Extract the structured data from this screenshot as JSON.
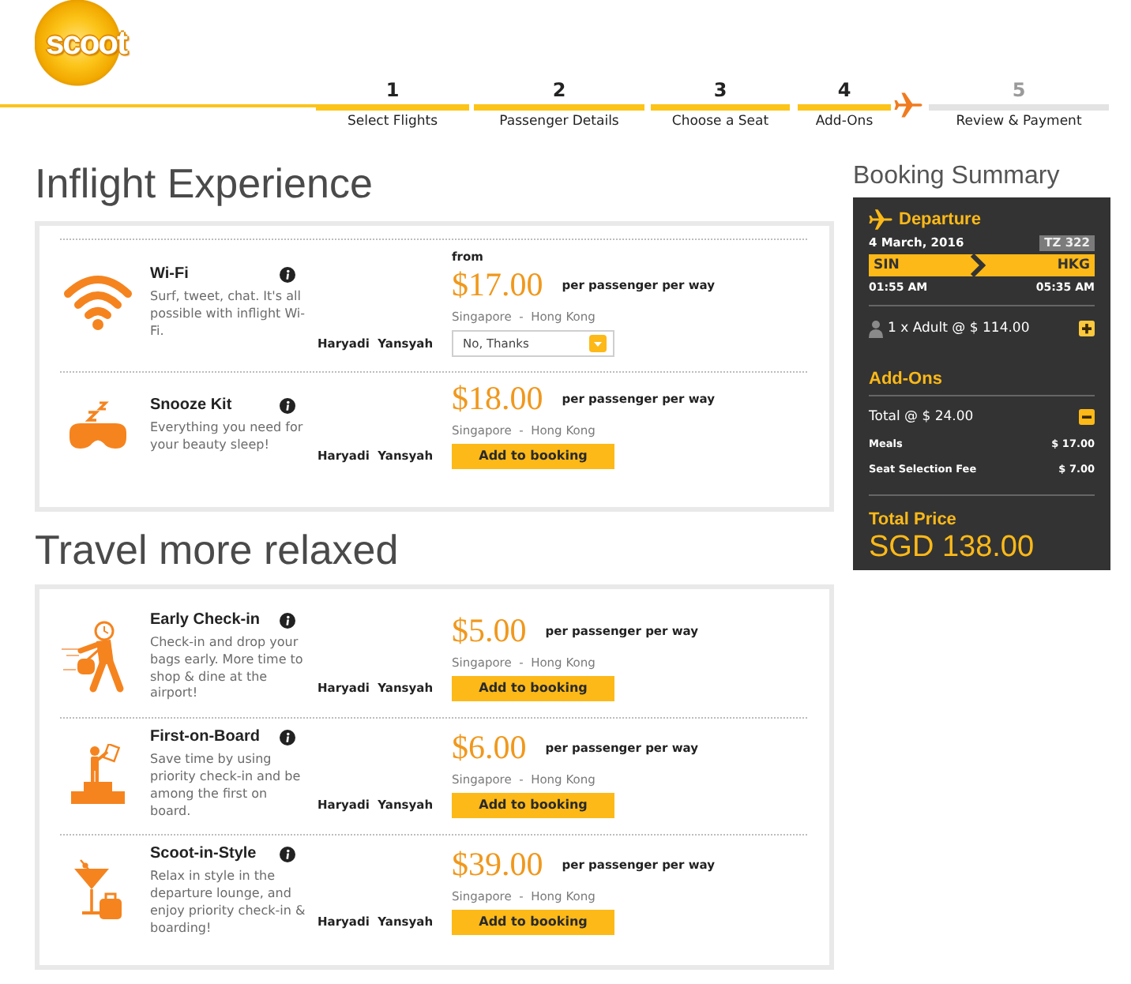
{
  "header": {
    "logo": "scoot",
    "steps": [
      {
        "number": "1",
        "label": "Select Flights",
        "done": true
      },
      {
        "number": "2",
        "label": "Passenger Details",
        "done": true
      },
      {
        "number": "3",
        "label": "Choose a Seat",
        "done": true
      },
      {
        "number": "4",
        "label": "Add-Ons",
        "done": true
      },
      {
        "number": "5",
        "label": "Review & Payment",
        "done": false
      }
    ]
  },
  "sections": [
    {
      "title": "Inflight Experience",
      "items": [
        {
          "kind": "dropdown",
          "name": "Wi-Fi",
          "description": "Surf, tweet, chat. It's all possible with inflight Wi-Fi.",
          "passenger": "Haryadi  Yansyah",
          "from": "from",
          "price": "$17.00",
          "price_unit": "per passenger per way",
          "route": "Singapore  -  Hong Kong",
          "select_value": "No, Thanks"
        },
        {
          "kind": "button",
          "name": "Snooze Kit",
          "description": "Everything you need for your beauty sleep!",
          "passenger": "Haryadi  Yansyah",
          "price": "$18.00",
          "price_unit": "per passenger per way",
          "route": "Singapore  -  Hong Kong",
          "button": "Add to booking"
        }
      ]
    },
    {
      "title": "Travel more relaxed",
      "items": [
        {
          "kind": "button",
          "name": "Early Check-in",
          "description": "Check-in and drop your bags early. More time to shop & dine at the airport!",
          "passenger": "Haryadi  Yansyah",
          "price": "$5.00",
          "price_unit": "per passenger per way",
          "route": "Singapore  -  Hong Kong",
          "button": "Add to booking"
        },
        {
          "kind": "button",
          "name": "First-on-Board",
          "description": "Save time by using priority check-in and be among the first on board.",
          "passenger": "Haryadi  Yansyah",
          "price": "$6.00",
          "price_unit": "per passenger per way",
          "route": "Singapore  -  Hong Kong",
          "button": "Add to booking"
        },
        {
          "kind": "button",
          "name": "Scoot-in-Style",
          "description": "Relax in style in the departure lounge, and enjoy priority check-in & boarding!",
          "passenger": "Haryadi  Yansyah",
          "price": "$39.00",
          "price_unit": "per passenger per way",
          "route": "Singapore  -  Hong Kong",
          "button": "Add to booking"
        }
      ]
    }
  ],
  "summary": {
    "title": "Booking Summary",
    "flight": {
      "heading": "Departure",
      "date": "4 March, 2016",
      "flight_number": "TZ 322",
      "origin": "SIN",
      "destination": "HKG",
      "departure_time": "01:55 AM",
      "arrival_time": "05:35 AM"
    },
    "passengers": {
      "label": "1 x Adult @ $ 114.00",
      "expanded": false
    },
    "addons": {
      "heading": "Add-Ons",
      "label": "Total @ $ 24.00",
      "expanded": true,
      "items": [
        {
          "name": "Meals",
          "amount": "$ 17.00"
        },
        {
          "name": "Seat Selection Fee",
          "amount": "$ 7.00"
        }
      ]
    },
    "total": {
      "label": "Total Price",
      "amount": "SGD 138.00"
    }
  }
}
